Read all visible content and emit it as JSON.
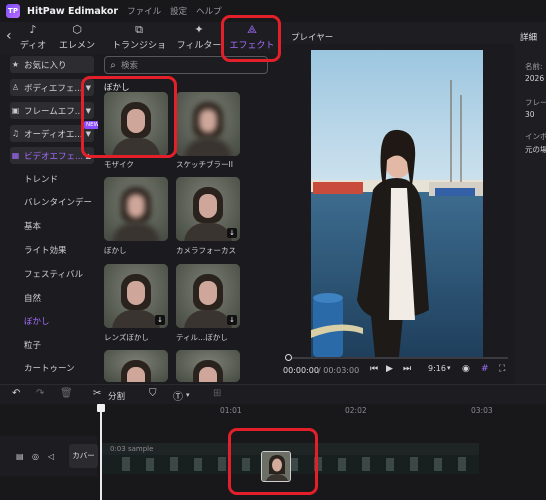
{
  "app": {
    "title": "HitPaw Edimakor",
    "logo_text": "TP"
  },
  "menu": [
    "ファイル",
    "設定",
    "ヘルプ"
  ],
  "tabs": [
    {
      "label": "ディオ",
      "icon": "audio-icon"
    },
    {
      "label": "エレメント",
      "icon": "element-icon"
    },
    {
      "label": "トランジション",
      "icon": "transition-icon"
    },
    {
      "label": "フィルター",
      "icon": "filter-icon"
    },
    {
      "label": "エフェクト",
      "icon": "effect-icon",
      "active": true
    }
  ],
  "sidebar": {
    "categories": [
      {
        "label": "お気に入り"
      },
      {
        "label": "ボディエフェ..."
      },
      {
        "label": "フレームエフ..."
      },
      {
        "label": "オーディオエ...",
        "badge": "NEW"
      },
      {
        "label": "ビデオエフェ...",
        "active": true
      }
    ],
    "subcategories": [
      "トレンド",
      "バレンタインデー",
      "基本",
      "ライト効果",
      "フェスティバル",
      "自然",
      "ぼかし",
      "粒子",
      "カートゥーン"
    ],
    "active_sub": "ぼかし"
  },
  "search": {
    "placeholder": "検索"
  },
  "effects": {
    "section_title": "ぼかし",
    "items": [
      {
        "label": "モザイク"
      },
      {
        "label": "スケッチブラーII"
      },
      {
        "label": "ぼかし"
      },
      {
        "label": "カメラフォーカス",
        "download": true
      },
      {
        "label": "レンズぼかし",
        "download": true
      },
      {
        "label": "ティル...ぼかし",
        "download": true
      }
    ]
  },
  "player": {
    "title": "プレイヤー",
    "time_current": "00:00:00",
    "time_total": "/ 00:03:00",
    "aspect": "9:16"
  },
  "details": {
    "tab": "詳細",
    "name_label": "名前:",
    "name_value": "2026",
    "frame_label": "フレー",
    "frame_value": "30",
    "import_label": "インポ",
    "import_value": "元の場"
  },
  "timeline": {
    "split_label": "分割",
    "ruler": [
      "01:01",
      "02:02",
      "03:03"
    ],
    "cover_label": "カバー",
    "clip_name": "0:03 sample"
  },
  "colors": {
    "accent": "#a46dff",
    "highlight": "#e3202a",
    "background": "#1b1b1f"
  }
}
